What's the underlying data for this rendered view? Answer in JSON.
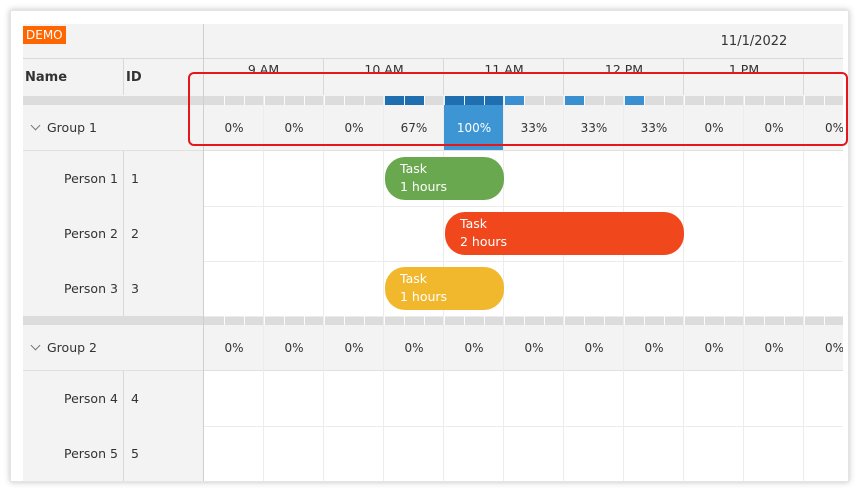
{
  "demo_badge": "DEMO",
  "header": {
    "date": "11/1/2022",
    "hours": [
      "9 AM",
      "10 AM",
      "11 AM",
      "12 PM",
      "1 PM"
    ],
    "columns": {
      "name": "Name",
      "id": "ID"
    }
  },
  "groups": [
    {
      "name": "Group 1",
      "percents": [
        "0%",
        "0%",
        "0%",
        "67%",
        "100%",
        "33%",
        "33%",
        "33%",
        "0%",
        "0%",
        "0%"
      ]
    },
    {
      "name": "Group 2",
      "percents": [
        "0%",
        "0%",
        "0%",
        "0%",
        "0%",
        "0%",
        "0%",
        "0%",
        "0%",
        "0%",
        "0%"
      ]
    }
  ],
  "resources": [
    {
      "name": "Person 1",
      "id": "1"
    },
    {
      "name": "Person 2",
      "id": "2"
    },
    {
      "name": "Person 3",
      "id": "3"
    },
    {
      "name": "Person 4",
      "id": "4"
    },
    {
      "name": "Person 5",
      "id": "5"
    }
  ],
  "events": [
    {
      "title": "Task",
      "duration": "1 hours",
      "color": "#6aa84f"
    },
    {
      "title": "Task",
      "duration": "2 hours",
      "color": "#f1471d"
    },
    {
      "title": "Task",
      "duration": "1 hours",
      "color": "#f1b82d"
    }
  ],
  "colors": {
    "highlight_cell": "#3d96d3",
    "strip_dark": "#1f6fb0",
    "strip_light": "#3a8fd0",
    "annotation": "#e5171b"
  }
}
